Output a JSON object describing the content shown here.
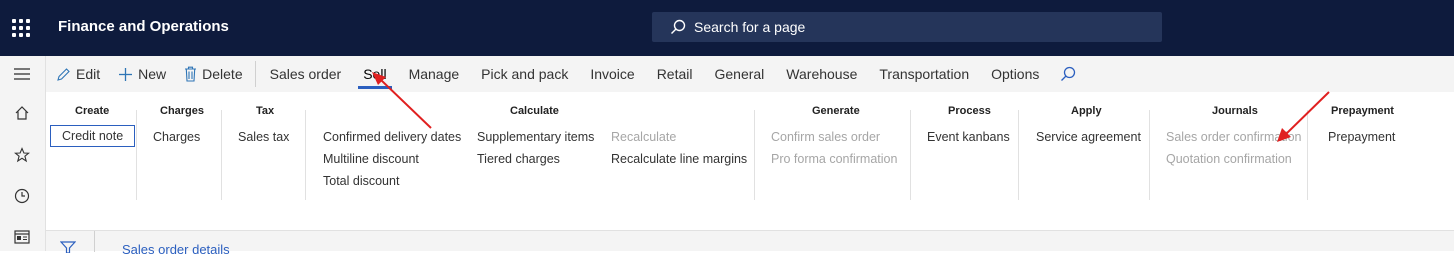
{
  "app": {
    "title": "Finance and Operations"
  },
  "search": {
    "label": "Search for a page"
  },
  "actions": {
    "edit": "Edit",
    "new": "New",
    "delete": "Delete"
  },
  "tabs": [
    "Sales order",
    "Sell",
    "Manage",
    "Pick and pack",
    "Invoice",
    "Retail",
    "General",
    "Warehouse",
    "Transportation",
    "Options"
  ],
  "selected_tab": "Sell",
  "ribbon": {
    "create": {
      "title": "Create",
      "items": [
        "Credit note"
      ]
    },
    "charges": {
      "title": "Charges",
      "items": [
        "Charges"
      ]
    },
    "tax": {
      "title": "Tax",
      "items": [
        "Sales tax"
      ]
    },
    "calculate": {
      "title": "Calculate",
      "col1": [
        "Confirmed delivery dates",
        "Multiline discount",
        "Total discount"
      ],
      "col2": [
        "Supplementary items",
        "Tiered charges"
      ],
      "col3": [
        "Recalculate",
        "Recalculate line margins"
      ]
    },
    "generate": {
      "title": "Generate",
      "items": [
        "Confirm sales order",
        "Pro forma confirmation"
      ]
    },
    "process": {
      "title": "Process",
      "items": [
        "Event kanbans"
      ]
    },
    "apply": {
      "title": "Apply",
      "items": [
        "Service agreement"
      ]
    },
    "journals": {
      "title": "Journals",
      "items": [
        "Sales order confirmation",
        "Quotation confirmation"
      ]
    },
    "prepayment": {
      "title": "Prepayment",
      "items": [
        "Prepayment"
      ]
    }
  },
  "bottom": {
    "text": "Sales order details"
  },
  "colors": {
    "topbar": "#0e1b3d",
    "accent": "#2b5fbf",
    "annotation": "#e02020",
    "disabled": "#a6a6a6"
  },
  "icons": [
    "waffle-icon",
    "search-icon",
    "hamburger-icon",
    "home-icon",
    "star-icon",
    "clock-icon",
    "workspace-icon",
    "edit-icon",
    "plus-icon",
    "delete-icon",
    "filter-icon"
  ]
}
